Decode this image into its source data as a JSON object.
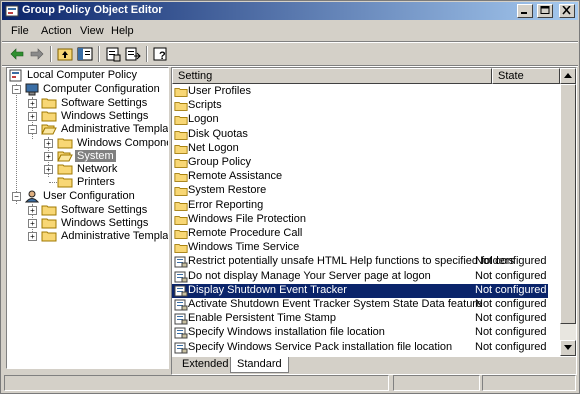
{
  "window": {
    "title": "Group Policy Object Editor"
  },
  "menu": {
    "file": "File",
    "action": "Action",
    "view": "View",
    "help": "Help"
  },
  "tree": {
    "root": "Local Computer Policy",
    "computer_configuration": "Computer Configuration",
    "software_settings": "Software Settings",
    "windows_settings": "Windows Settings",
    "administrative_templates": "Administrative Templates",
    "windows_components": "Windows Components",
    "system": "System",
    "network": "Network",
    "printers": "Printers",
    "user_configuration": "User Configuration",
    "user_software_settings": "Software Settings",
    "user_windows_settings": "Windows Settings",
    "user_administrative_templates": "Administrative Templates"
  },
  "columns": {
    "setting": "Setting",
    "state": "State"
  },
  "rows": [
    {
      "name": "User Profiles",
      "state": "",
      "icon": "folder-icon"
    },
    {
      "name": "Scripts",
      "state": "",
      "icon": "folder-icon"
    },
    {
      "name": "Logon",
      "state": "",
      "icon": "folder-icon"
    },
    {
      "name": "Disk Quotas",
      "state": "",
      "icon": "folder-icon"
    },
    {
      "name": "Net Logon",
      "state": "",
      "icon": "folder-icon"
    },
    {
      "name": "Group Policy",
      "state": "",
      "icon": "folder-icon"
    },
    {
      "name": "Remote Assistance",
      "state": "",
      "icon": "folder-icon"
    },
    {
      "name": "System Restore",
      "state": "",
      "icon": "folder-icon"
    },
    {
      "name": "Error Reporting",
      "state": "",
      "icon": "folder-icon"
    },
    {
      "name": "Windows File Protection",
      "state": "",
      "icon": "folder-icon"
    },
    {
      "name": "Remote Procedure Call",
      "state": "",
      "icon": "folder-icon"
    },
    {
      "name": "Windows Time Service",
      "state": "",
      "icon": "folder-icon"
    },
    {
      "name": "Restrict potentially unsafe HTML Help functions to specified folders",
      "state": "Not configured",
      "icon": "policy-setting-icon"
    },
    {
      "name": "Do not display Manage Your Server page at logon",
      "state": "Not configured",
      "icon": "policy-setting-icon"
    },
    {
      "name": "Display Shutdown Event Tracker",
      "state": "Not configured",
      "icon": "policy-setting-icon",
      "selected": true
    },
    {
      "name": "Activate Shutdown Event Tracker System State Data feature",
      "state": "Not configured",
      "icon": "policy-setting-icon"
    },
    {
      "name": "Enable Persistent Time Stamp",
      "state": "Not configured",
      "icon": "policy-setting-icon"
    },
    {
      "name": "Specify Windows installation file location",
      "state": "Not configured",
      "icon": "policy-setting-icon"
    },
    {
      "name": "Specify Windows Service Pack installation file location",
      "state": "Not configured",
      "icon": "policy-setting-icon"
    }
  ],
  "tabs": {
    "extended": "Extended",
    "standard": "Standard"
  },
  "colors": {
    "selection": "#0a246a",
    "folder": "#f8d775",
    "titlebar_start": "#0a246a",
    "titlebar_end": "#a6caf0"
  }
}
